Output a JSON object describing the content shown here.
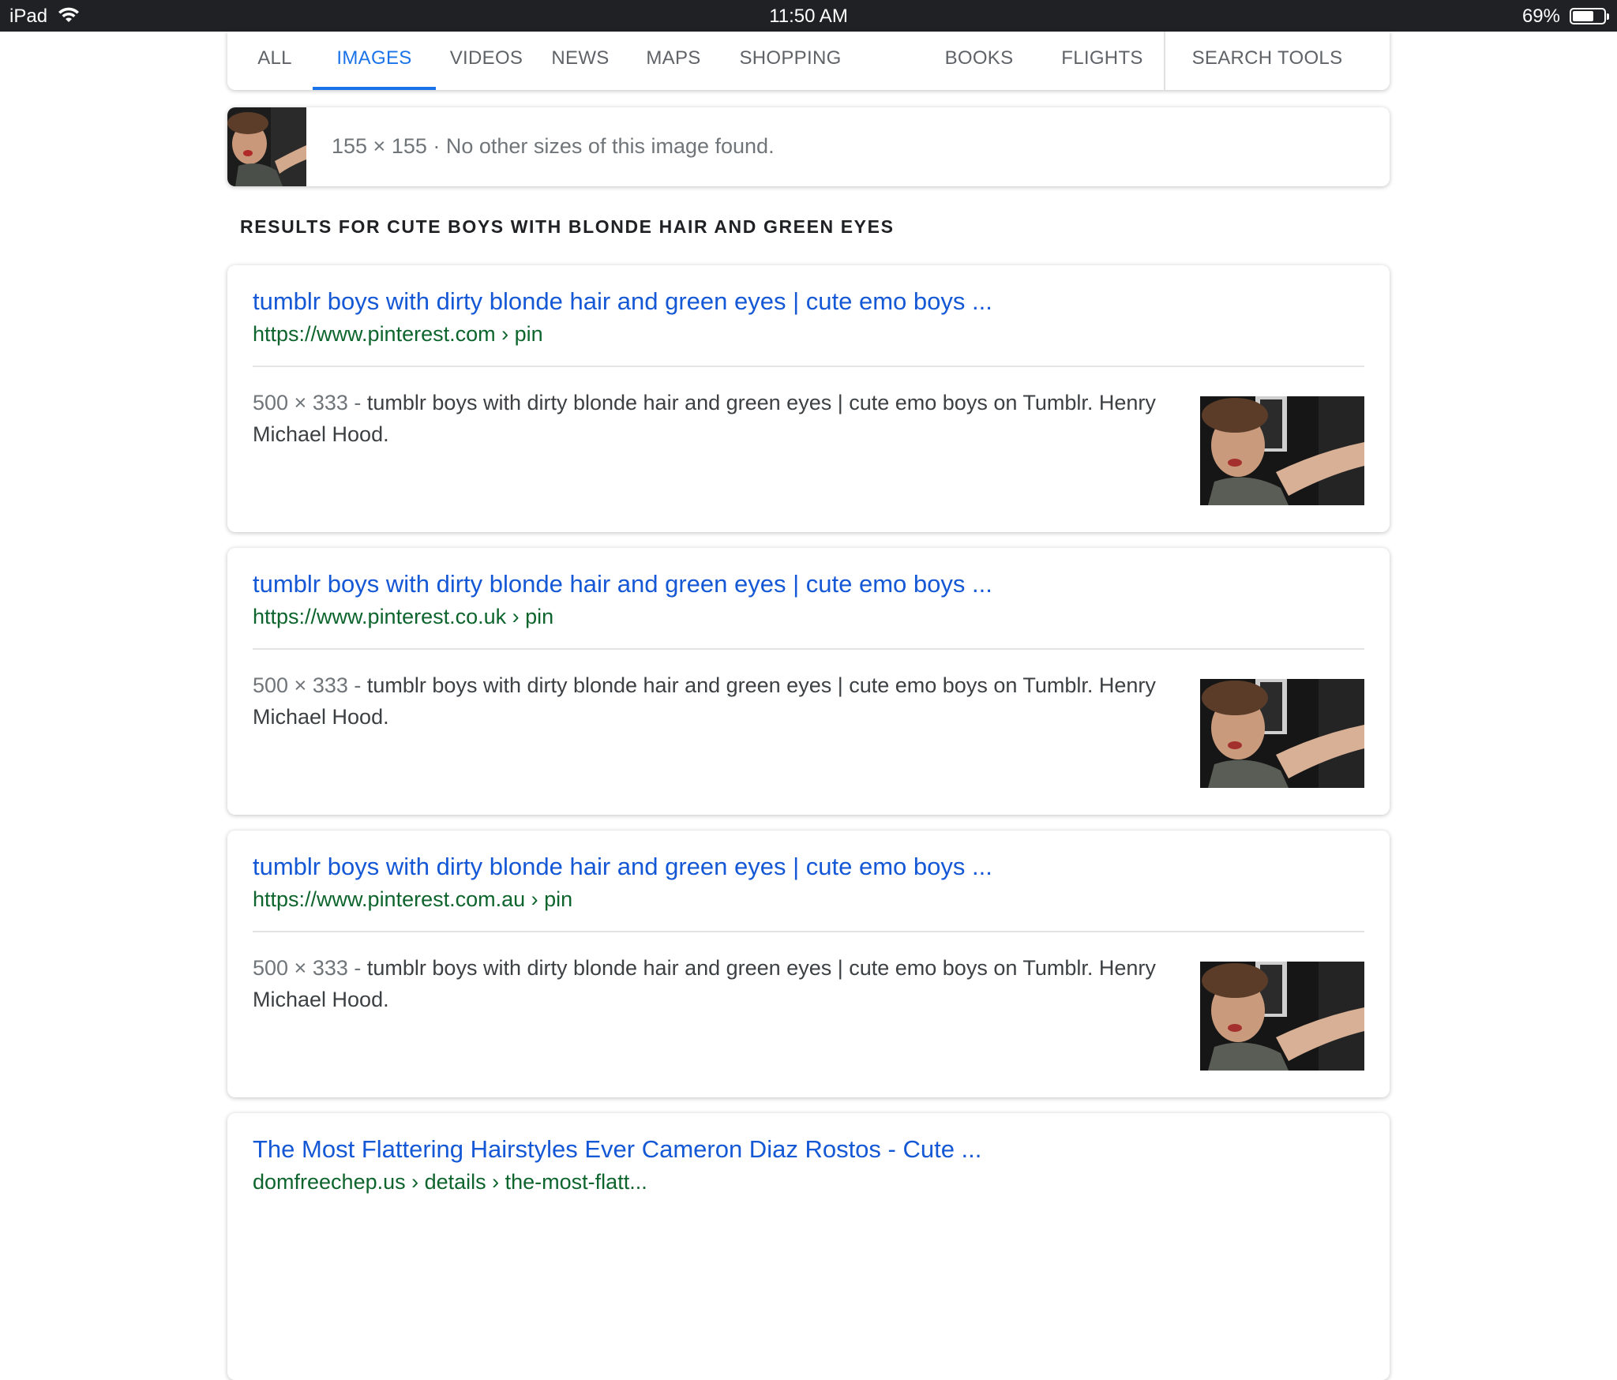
{
  "status_bar": {
    "device": "iPad",
    "time": "11:50 AM",
    "battery_percent": "69%",
    "battery_level": 0.69
  },
  "tabs": [
    {
      "label": "ALL",
      "active": false
    },
    {
      "label": "IMAGES",
      "active": true
    },
    {
      "label": "VIDEOS",
      "active": false
    },
    {
      "label": "NEWS",
      "active": false
    },
    {
      "label": "MAPS",
      "active": false
    },
    {
      "label": "SHOPPING",
      "active": false
    },
    {
      "label": "BOOKS",
      "active": false
    },
    {
      "label": "FLIGHTS",
      "active": false
    }
  ],
  "search_tools_label": "SEARCH TOOLS",
  "image_info": {
    "text": "155 × 155 · No other sizes of this image found."
  },
  "results_heading": "RESULTS FOR CUTE BOYS WITH BLONDE HAIR AND GREEN EYES",
  "results": [
    {
      "title": "tumblr boys with dirty blonde hair and green eyes | cute emo boys ...",
      "url": "https://www.pinterest.com › pin",
      "dims": "500 × 333 -",
      "snippet": "tumblr boys with dirty blonde hair and green eyes | cute emo boys on Tumblr. Henry Michael Hood."
    },
    {
      "title": "tumblr boys with dirty blonde hair and green eyes | cute emo boys ...",
      "url": "https://www.pinterest.co.uk › pin",
      "dims": "500 × 333 -",
      "snippet": "tumblr boys with dirty blonde hair and green eyes | cute emo boys on Tumblr. Henry Michael Hood."
    },
    {
      "title": "tumblr boys with dirty blonde hair and green eyes | cute emo boys ...",
      "url": "https://www.pinterest.com.au › pin",
      "dims": "500 × 333 -",
      "snippet": "tumblr boys with dirty blonde hair and green eyes | cute emo boys on Tumblr. Henry Michael Hood."
    },
    {
      "title": "The Most Flattering Hairstyles Ever Cameron Diaz Rostos - Cute ...",
      "url": "domfreechep.us › details › the-most-flatt...",
      "dims": "",
      "snippet": ""
    }
  ],
  "colors": {
    "link_blue": "#1558d6",
    "url_green": "#0d652d",
    "active_tab": "#1a73e8",
    "status_bar_bg": "#202124"
  }
}
